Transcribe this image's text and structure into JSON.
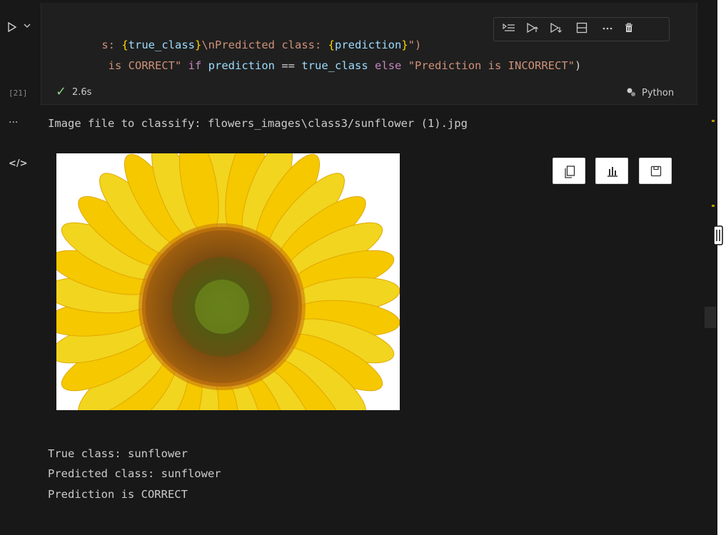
{
  "cell": {
    "code_line_1_prefix": "s: ",
    "code_line_1_brace1": "{",
    "code_line_1_var1": "true_class",
    "code_line_1_brace2": "}",
    "code_line_1_mid": "\\nPredicted class: ",
    "code_line_1_brace3": "{",
    "code_line_1_var2": "prediction",
    "code_line_1_brace4": "}",
    "code_line_1_end": "\")",
    "code_line_2_str1": " is CORRECT\"",
    "code_line_2_kw1": "if",
    "code_line_2_var1": "prediction",
    "code_line_2_op": "==",
    "code_line_2_var2": "true_class",
    "code_line_2_kw2": "else",
    "code_line_2_str2": "\"Prediction is INCORRECT\"",
    "code_line_2_end": ")",
    "execution_count": "[21]",
    "check_mark": "✓",
    "exec_time": "2.6s",
    "kernel_label": "Python"
  },
  "output": {
    "image_file_line": "Image file to classify: flowers_images\\class3/sunflower (1).jpg",
    "true_class_line": "True class: sunflower",
    "predicted_class_line": "Predicted class: sunflower",
    "verdict_line": "Prediction is CORRECT",
    "more_glyph": "···",
    "code_glyph": "</>"
  },
  "toolbar_icons": [
    "run-by-line-icon",
    "execute-above-icon",
    "execute-below-icon",
    "split-cell-icon",
    "more-icon",
    "delete-icon"
  ],
  "image_actions": [
    "copy-icon",
    "chart-icon",
    "save-icon"
  ],
  "colors": {
    "background": "#181818",
    "success_check": "#89d185",
    "string": "#ce9178",
    "variable": "#9cdcfe",
    "keyword": "#c586c0",
    "brace": "#ffd700"
  }
}
